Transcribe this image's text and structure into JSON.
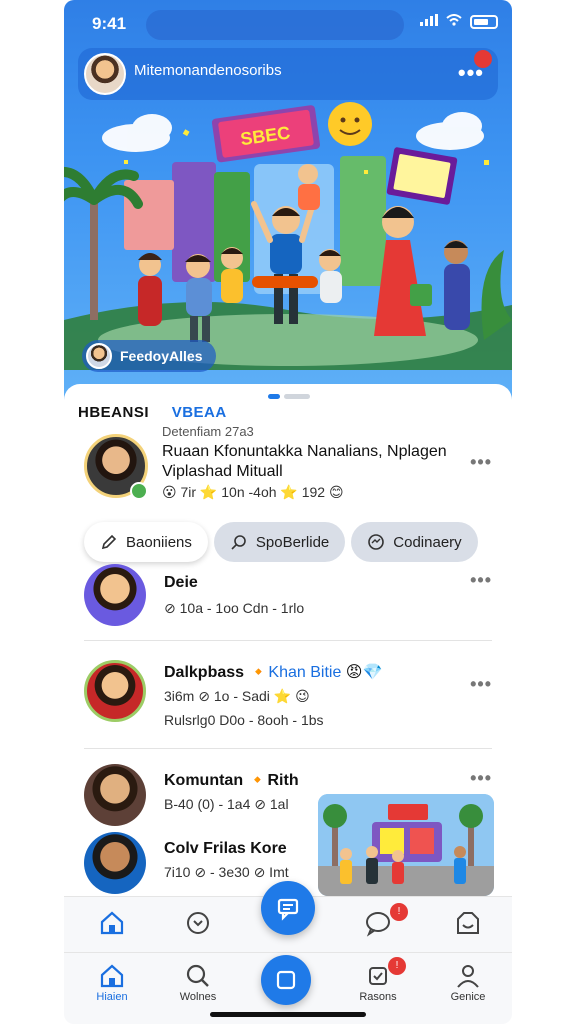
{
  "status_bar": {
    "time": "9:41"
  },
  "header": {
    "title": "Mitemonandenosoribs",
    "notification_count": ""
  },
  "hero": {
    "chip_label": "FeedoyAlles"
  },
  "section": {
    "title": "HBEANSI",
    "title_accent": "VBEAA",
    "date": "Detenfiam 27a3"
  },
  "featured": {
    "title": "Ruaan Kfonuntakka Nanalians, Nplagen Viplashad Mituall",
    "meta": "😮 7ir ⭐ 10n -4oh ⭐ 192 😊"
  },
  "chips": [
    {
      "label": "Baoniiens",
      "icon": "pencil-icon"
    },
    {
      "label": "SpoBerlide",
      "icon": "search-icon"
    },
    {
      "label": "Codinaery",
      "icon": "chat-icon"
    }
  ],
  "list": [
    {
      "name": "Deie",
      "name_accent": "",
      "meta1": "⊘ 10a -  1oo  Cdn - 1rlo",
      "meta2": ""
    },
    {
      "name": "Dalkpbass",
      "name_accent": "Khan Bitie",
      "meta1": "3i6m  ⊘ 1o - Sadi ⭐ 😉",
      "meta2": "Rulsrlg0 D0o - 8ooh - 1bs"
    },
    {
      "name": "Komuntan",
      "name_accent": "Rith",
      "meta1": "B-40 (0) -  1a4  ⊘ 1al",
      "meta2": ""
    },
    {
      "name": "Colv Frilas Kore",
      "name_accent": "",
      "meta1": "7i10  ⊘ - 3e30 ⊘ Imt",
      "meta2": ""
    }
  ],
  "tabbar_bottom": [
    {
      "label": "Hiaien"
    },
    {
      "label": "Wolnes"
    },
    {
      "label": ""
    },
    {
      "label": "Rasons"
    },
    {
      "label": "Genice"
    }
  ],
  "colors": {
    "primary": "#1f7ae8",
    "accent_text": "#1a6fe0",
    "badge": "#e53935"
  }
}
